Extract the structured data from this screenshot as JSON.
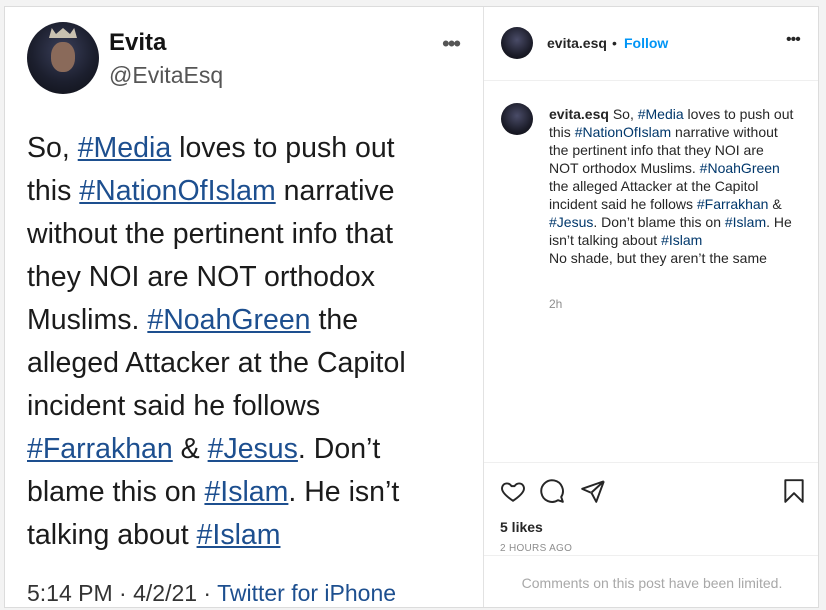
{
  "tweet": {
    "name": "Evita",
    "handle": "@EvitaEsq",
    "lines": [
      [
        {
          "t": "So, "
        },
        {
          "h": "#Media"
        },
        {
          "t": " loves to push out"
        }
      ],
      [
        {
          "t": "this "
        },
        {
          "h": "#NationOfIslam"
        },
        {
          "t": " narrative"
        }
      ],
      [
        {
          "t": "without the pertinent info that"
        }
      ],
      [
        {
          "t": "they NOI are NOT orthodox"
        }
      ],
      [
        {
          "t": "Muslims. "
        },
        {
          "h": "#NoahGreen"
        },
        {
          "t": " the"
        }
      ],
      [
        {
          "t": "alleged Attacker at the Capitol"
        }
      ],
      [
        {
          "t": "incident said he follows"
        }
      ],
      [
        {
          "h": "#Farrakhan"
        },
        {
          "t": " & "
        },
        {
          "h": "#Jesus"
        },
        {
          "t": ". Don’t"
        }
      ],
      [
        {
          "t": "blame this on "
        },
        {
          "h": "#Islam"
        },
        {
          "t": ". He isn’t"
        }
      ],
      [
        {
          "t": "talking about "
        },
        {
          "h": "#Islam"
        }
      ]
    ],
    "time": "5:14 PM · 4/2/21 · ",
    "source": "Twitter for iPhone"
  },
  "post": {
    "username": "evita.esq",
    "dot": "•",
    "follow_label": "Follow",
    "caption_lines": [
      [
        {
          "u": "evita.esq"
        },
        {
          "t": " So, "
        },
        {
          "h": "#Media"
        },
        {
          "t": " loves to push out"
        }
      ],
      [
        {
          "t": "this "
        },
        {
          "h": "#NationOfIslam"
        },
        {
          "t": " narrative without"
        }
      ],
      [
        {
          "t": "the pertinent info that they NOI are"
        }
      ],
      [
        {
          "t": "NOT orthodox Muslims. "
        },
        {
          "h": "#NoahGreen"
        }
      ],
      [
        {
          "t": "the alleged Attacker at the Capitol"
        }
      ],
      [
        {
          "t": "incident said he follows "
        },
        {
          "h": "#Farrakhan"
        },
        {
          "t": " &"
        }
      ],
      [
        {
          "h": "#Jesus"
        },
        {
          "t": ". Don’t blame this on "
        },
        {
          "h": "#Islam"
        },
        {
          "t": ". He"
        }
      ],
      [
        {
          "t": "isn’t talking about "
        },
        {
          "h": "#Islam"
        }
      ],
      [
        {
          "t": " "
        }
      ],
      [
        {
          "t": "No shade, but they aren’t the same"
        }
      ]
    ],
    "caption_time": "2h",
    "likes": "5 likes",
    "posted_ago": "2 HOURS AGO",
    "comments_limited": "Comments on this post have been limited.",
    "icons": [
      "heart-icon",
      "comment-icon",
      "share-icon",
      "bookmark-icon",
      "more-options-icon"
    ],
    "colors": {
      "link": "#0095f6",
      "hashtag": "#00376b",
      "tweet_link": "#1d4f8f"
    }
  }
}
